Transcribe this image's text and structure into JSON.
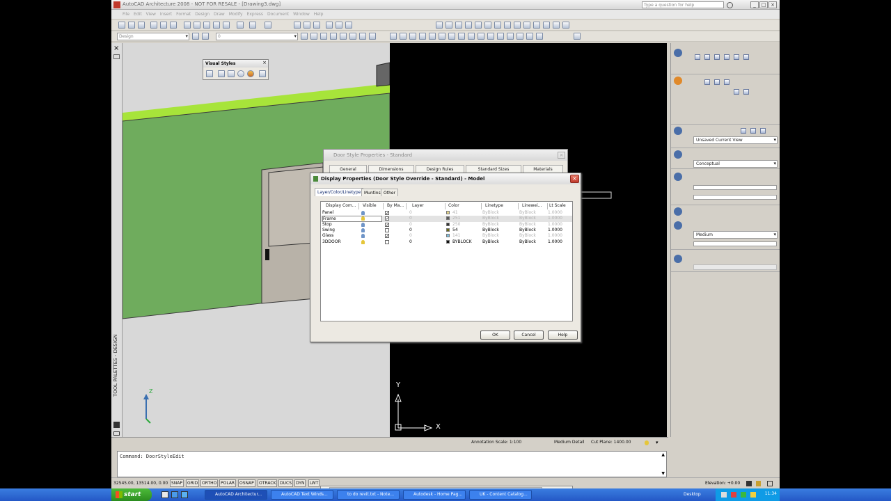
{
  "window": {
    "title": "AutoCAD Architecture 2008 - NOT FOR RESALE - [Drawing3.dwg]",
    "question_placeholder": "Type a question for help"
  },
  "menu": [
    "File",
    "Edit",
    "View",
    "Insert",
    "Format",
    "Design",
    "Draw",
    "Modify",
    "Express",
    "Document",
    "Window",
    "Help"
  ],
  "toolbar": {
    "layer_combo": "Design",
    "layer_combo2": "0"
  },
  "visual_styles": {
    "title": "Visual Styles"
  },
  "tool_palette": {
    "label": "TOOL PALETTES - DESIGN"
  },
  "right_panel": {
    "view_combo": "Unsaved Current View",
    "style_combo": "Conceptual",
    "detail_combo": "Medium"
  },
  "back_dialog": {
    "title": "Door Style Properties - Standard",
    "tabs": [
      "General",
      "Dimensions",
      "Design Rules",
      "Standard Sizes",
      "Materials"
    ]
  },
  "dialog": {
    "title": "Display Properties (Door Style Override - Standard) - Model",
    "tabs": [
      "Layer/Color/Linetype",
      "Muntins",
      "Other"
    ],
    "columns": [
      "Display Com...",
      "Visible",
      "By Ma...",
      "Layer",
      "Color",
      "Linetype",
      "Linewei...",
      "Lt Scale"
    ],
    "rows": [
      {
        "name": "Panel",
        "visible": "on",
        "bymat": true,
        "layer": "0",
        "color": "41",
        "color_hex": "#e3d48a",
        "linetype": "ByBlock",
        "lineweight": "ByBlock",
        "ltscale": "1.0000",
        "dim": true
      },
      {
        "name": "Frame",
        "visible": "on",
        "bymat": true,
        "layer": "0",
        "color": "251",
        "color_hex": "#5a5a5a",
        "linetype": "ByBlock",
        "lineweight": "ByBlock",
        "ltscale": "1.0000",
        "dim": true
      },
      {
        "name": "Stop",
        "visible": "on",
        "bymat": true,
        "layer": "0",
        "color": "250",
        "color_hex": "#333333",
        "linetype": "ByBlock",
        "lineweight": "ByBlock",
        "ltscale": "1.0000",
        "dim": true
      },
      {
        "name": "Swing",
        "visible": "on",
        "bymat": false,
        "layer": "0",
        "color": "54",
        "color_hex": "#6b6b14",
        "linetype": "ByBlock",
        "lineweight": "ByBlock",
        "ltscale": "1.0000",
        "dim": false
      },
      {
        "name": "Glass",
        "visible": "on",
        "bymat": true,
        "layer": "0",
        "color": "141",
        "color_hex": "#7fbfdf",
        "linetype": "ByBlock",
        "lineweight": "ByBlock",
        "ltscale": "1.0000",
        "dim": true
      },
      {
        "name": "3DDOOR",
        "visible": "on",
        "bymat": false,
        "layer": "0",
        "color": "BYBLOCK",
        "color_hex": "#111111",
        "linetype": "ByBlock",
        "lineweight": "ByBlock",
        "ltscale": "1.0000",
        "dim": false
      }
    ],
    "buttons": {
      "ok": "OK",
      "cancel": "Cancel",
      "help": "Help"
    }
  },
  "status": {
    "annotation_scale": "Annotation Scale: 1:100",
    "detail": "Medium Detail",
    "cut_plane": "Cut Plane: 1400.00"
  },
  "command": {
    "text": "Command: DoorStyleEdit"
  },
  "bottom": {
    "coords": "32545.00, 13514.00, 0.00",
    "toggles": [
      "SNAP",
      "GRID",
      "ORTHO",
      "POLAR",
      "OSNAP",
      "OTRACK",
      "DUCS",
      "DYN",
      "LWT"
    ],
    "elevation": "Elevation: +0.00"
  },
  "axes": {
    "y": "Y",
    "x": "X",
    "z": "Z"
  },
  "taskbar": {
    "start": "start",
    "tasks": [
      "AutoCAD Architectur...",
      "AutoCAD Text Winds...",
      "to do revit.txt - Note...",
      "Autodesk - Home Pag...",
      "UK - Content Catalog..."
    ],
    "desktop": "Desktop",
    "clock": "11:34"
  }
}
